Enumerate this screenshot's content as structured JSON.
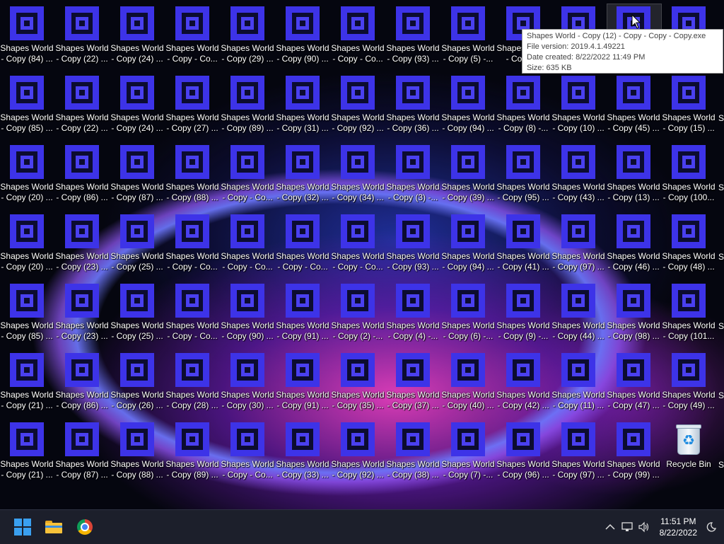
{
  "desktop": {
    "columns": [
      [
        "Shapes World - Copy (84) ...",
        "Shapes World - Copy (85) ...",
        "Shapes World - Copy (20) ...",
        "Shapes World - Copy (20) ...",
        "Shapes World - Copy (85) ...",
        "Shapes World - Copy (21) ...",
        "Shapes World - Copy (21) ..."
      ],
      [
        "Shapes World - Copy (22) ...",
        "Shapes World - Copy (22) ...",
        "Shapes World - Copy (86) ...",
        "Shapes World - Copy (23) ...",
        "Shapes World - Copy (23) ...",
        "Shapes World - Copy (86) ...",
        "Shapes World - Copy (87) ..."
      ],
      [
        "Shapes World - Copy (24) ...",
        "Shapes World - Copy (24) ...",
        "Shapes World - Copy (87) ...",
        "Shapes World - Copy (25) ...",
        "Shapes World - Copy (25) ...",
        "Shapes World - Copy (26) ...",
        "Shapes World - Copy (88) ..."
      ],
      [
        "Shapes World - Copy - Co...",
        "Shapes World - Copy (27) ...",
        "Shapes World - Copy (88) ...",
        "Shapes World - Copy - Co...",
        "Shapes World - Copy - Co...",
        "Shapes World - Copy (28) ...",
        "Shapes World - Copy (89) ..."
      ],
      [
        "Shapes World - Copy (29) ...",
        "Shapes World - Copy (89) ...",
        "Shapes World - Copy - Co...",
        "Shapes World - Copy - Co...",
        "Shapes World - Copy (90) ...",
        "Shapes World - Copy (30) ...",
        "Shapes World - Copy - Co..."
      ],
      [
        "Shapes World - Copy (90) ...",
        "Shapes World - Copy (31) ...",
        "Shapes World - Copy (32) ...",
        "Shapes World - Copy - Co...",
        "Shapes World - Copy (91) ...",
        "Shapes World - Copy (91) ...",
        "Shapes World - Copy (33) ..."
      ],
      [
        "Shapes World - Copy - Co...",
        "Shapes World - Copy (92) ...",
        "Shapes World - Copy (34) ...",
        "Shapes World - Copy - Co...",
        "Shapes World - Copy (2) -...",
        "Shapes World - Copy (35) ...",
        "Shapes World - Copy (92) ..."
      ],
      [
        "Shapes World - Copy (93) ...",
        "Shapes World - Copy (36) ...",
        "Shapes World - Copy (3) -...",
        "Shapes World - Copy (93) ...",
        "Shapes World - Copy (4) -...",
        "Shapes World - Copy (37) ...",
        "Shapes World - Copy (38) ..."
      ],
      [
        "Shapes World - Copy (5) -...",
        "Shapes World - Copy (94) ...",
        "Shapes World - Copy (39) ...",
        "Shapes World - Copy (94) ...",
        "Shapes World - Copy (6) -...",
        "Shapes World - Copy (40) ...",
        "Shapes World - Copy (7) -..."
      ],
      [
        "Shapes World - Copy ...",
        "Shapes World - Copy (8) -...",
        "Shapes World - Copy (95) ...",
        "Shapes World - Copy (41) ...",
        "Shapes World - Copy (9) -...",
        "Shapes World - Copy (42) ...",
        "Shapes World - Copy (96) ..."
      ],
      [
        "Shapes World - Copy ...",
        "Shapes World - Copy (10) ...",
        "Shapes World - Copy (43) ...",
        "Shapes World - Copy (97) ...",
        "Shapes World - Copy (44) ...",
        "Shapes World - Copy (11) ...",
        "Shapes World - Copy (97) ..."
      ],
      [
        "Shapes World - Copy ...",
        "Shapes World - Copy (45) ...",
        "Shapes World - Copy (13) ...",
        "Shapes World - Copy (46) ...",
        "Shapes World - Copy (98) ...",
        "Shapes World - Copy (47) ...",
        "Shapes World - Copy (99) ..."
      ],
      [
        "Shapes World - Copy ...",
        "Shapes World - Copy (15) ...",
        "Shapes World - Copy (100...",
        "Shapes World - Copy (48) ...",
        "Shapes World - Copy (101...",
        "Shapes World - Copy (49) ...",
        "Recycle Bin"
      ]
    ],
    "edge_letter": "S"
  },
  "tooltip": {
    "line1": "Shapes World - Copy (12) - Copy - Copy - Copy.exe",
    "line2": "File version: 2019.4.1.49221",
    "line3": "Date created: 8/22/2022 11:49 PM",
    "line4": "Size: 635 KB"
  },
  "taskbar": {
    "start_icon": "windows-logo",
    "pinned": [
      "file-explorer",
      "chrome"
    ],
    "tray_icons": [
      "chevron-up",
      "network",
      "volume",
      "focus-assist"
    ],
    "time": "11:51 PM",
    "date": "8/22/2022"
  },
  "colors": {
    "app_icon": "#3d33e8",
    "taskbar": "#1c1f2b"
  }
}
